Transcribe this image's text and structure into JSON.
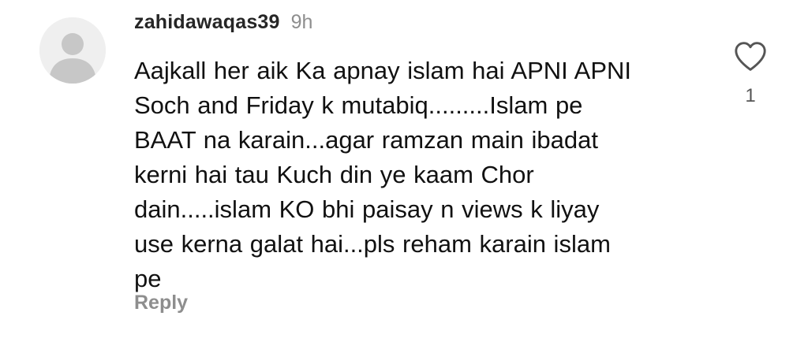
{
  "comment": {
    "username": "zahidawaqas39",
    "timestamp": "9h",
    "text": "Aajkall her aik Ka apnay islam hai APNI APNI\nSoch  and Friday k mutabiq.........Islam pe\nBAAT na karain...agar ramzan main ibadat\nkerni hai tau Kuch din ye kaam Chor\ndain.....islam KO bhi paisay n views k liyay\nuse kerna galat hai...pls reham karain islam\npe",
    "reply_label": "Reply",
    "like_count": "1",
    "avatar_icon": "default-avatar-icon",
    "like_icon": "heart-outline-icon"
  },
  "colors": {
    "username": "#262626",
    "meta_gray": "#8e8e8e",
    "avatar_bg": "#efefef",
    "avatar_fg": "#c7c7c7"
  }
}
